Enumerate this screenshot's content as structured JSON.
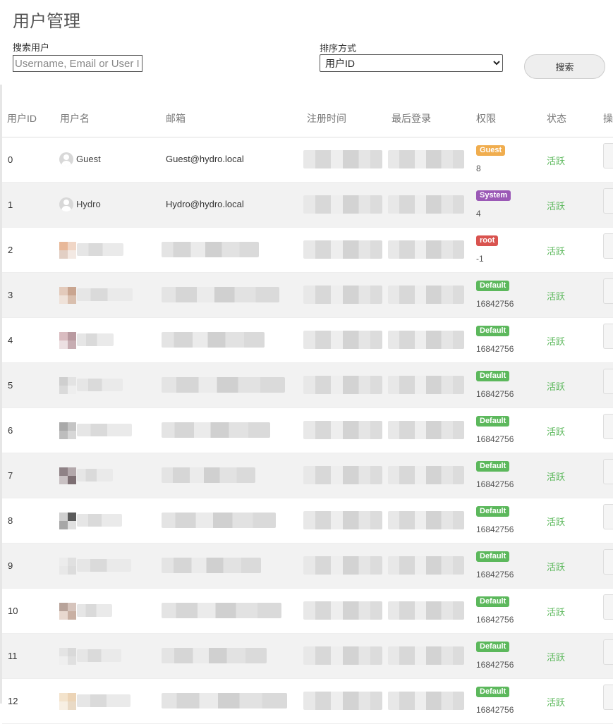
{
  "page": {
    "title": "用户管理"
  },
  "search": {
    "label": "搜索用户",
    "placeholder": "Username, Email or User ID"
  },
  "sort": {
    "label": "排序方式",
    "selected": "用户ID"
  },
  "search_button": "搜索",
  "table": {
    "columns": [
      "用户ID",
      "用户名",
      "邮箱",
      "注册时间",
      "最后登录",
      "权限",
      "状态",
      "操"
    ],
    "rows": [
      {
        "id": "0",
        "name": "Guest",
        "email": "Guest@hydro.local",
        "badge": "Guest",
        "badge_color": "#f0ad4e",
        "perm": "8",
        "status": "活跃"
      },
      {
        "id": "1",
        "name": "Hydro",
        "email": "Hydro@hydro.local",
        "badge": "System",
        "badge_color": "#9b59b6",
        "perm": "4",
        "status": "活跃"
      },
      {
        "id": "2",
        "name": "",
        "email": "",
        "badge": "root",
        "badge_color": "#d9534f",
        "perm": "-1",
        "status": "活跃"
      },
      {
        "id": "3",
        "name": "",
        "email": "",
        "badge": "Default",
        "badge_color": "#5cb85c",
        "perm": "16842756",
        "status": "活跃"
      },
      {
        "id": "4",
        "name": "",
        "email": "",
        "badge": "Default",
        "badge_color": "#5cb85c",
        "perm": "16842756",
        "status": "活跃"
      },
      {
        "id": "5",
        "name": "",
        "email": "",
        "badge": "Default",
        "badge_color": "#5cb85c",
        "perm": "16842756",
        "status": "活跃"
      },
      {
        "id": "6",
        "name": "",
        "email": "",
        "badge": "Default",
        "badge_color": "#5cb85c",
        "perm": "16842756",
        "status": "活跃"
      },
      {
        "id": "7",
        "name": "",
        "email": "",
        "badge": "Default",
        "badge_color": "#5cb85c",
        "perm": "16842756",
        "status": "活跃"
      },
      {
        "id": "8",
        "name": "",
        "email": "",
        "badge": "Default",
        "badge_color": "#5cb85c",
        "perm": "16842756",
        "status": "活跃"
      },
      {
        "id": "9",
        "name": "",
        "email": "",
        "badge": "Default",
        "badge_color": "#5cb85c",
        "perm": "16842756",
        "status": "活跃"
      },
      {
        "id": "10",
        "name": "",
        "email": "",
        "badge": "Default",
        "badge_color": "#5cb85c",
        "perm": "16842756",
        "status": "活跃"
      },
      {
        "id": "11",
        "name": "",
        "email": "",
        "badge": "Default",
        "badge_color": "#5cb85c",
        "perm": "16842756",
        "status": "活跃"
      },
      {
        "id": "12",
        "name": "",
        "email": "",
        "badge": "Default",
        "badge_color": "#5cb85c",
        "perm": "16842756",
        "status": "活跃"
      }
    ]
  }
}
